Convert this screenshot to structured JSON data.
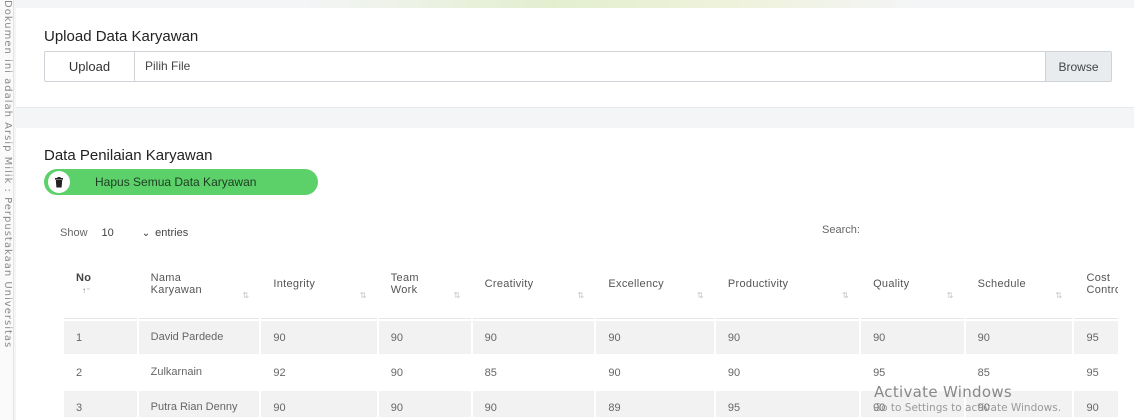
{
  "watermark": {
    "side_text": "Dokumen ini adalah Arsip Milik : Perpustakaan Universitas"
  },
  "upload": {
    "title": "Upload Data Karyawan",
    "button_label": "Upload",
    "file_label": "Pilih File",
    "browse_label": "Browse"
  },
  "data": {
    "title": "Data Penilaian Karyawan",
    "delete_all_label": "Hapus Semua Data Karyawan",
    "show_label": "Show",
    "page_size": "10",
    "entries_label": "entries",
    "search_label": "Search:"
  },
  "table": {
    "headers": [
      "No",
      "Nama Karyawan",
      "Integrity",
      "Team Work",
      "Creativity",
      "Excellency",
      "Productivity",
      "Quality",
      "Schedule",
      "Cost Control"
    ],
    "rows": [
      [
        "1",
        "David Pardede",
        "90",
        "90",
        "90",
        "90",
        "90",
        "90",
        "90",
        "95"
      ],
      [
        "2",
        "Zulkarnain",
        "92",
        "90",
        "85",
        "90",
        "90",
        "95",
        "85",
        "95"
      ],
      [
        "3",
        "Putra Rian Denny",
        "90",
        "90",
        "90",
        "89",
        "95",
        "90",
        "90",
        "90"
      ]
    ]
  },
  "os_overlay": {
    "title": "Activate Windows",
    "subtitle": "Go to Settings to activate Windows."
  },
  "colors": {
    "accent_green": "#5cd16a",
    "browse_bg": "#e9ecef"
  },
  "icons": {
    "delete": "trash-icon",
    "dropdown": "chevron-down-icon",
    "sort": "sort-icon"
  }
}
